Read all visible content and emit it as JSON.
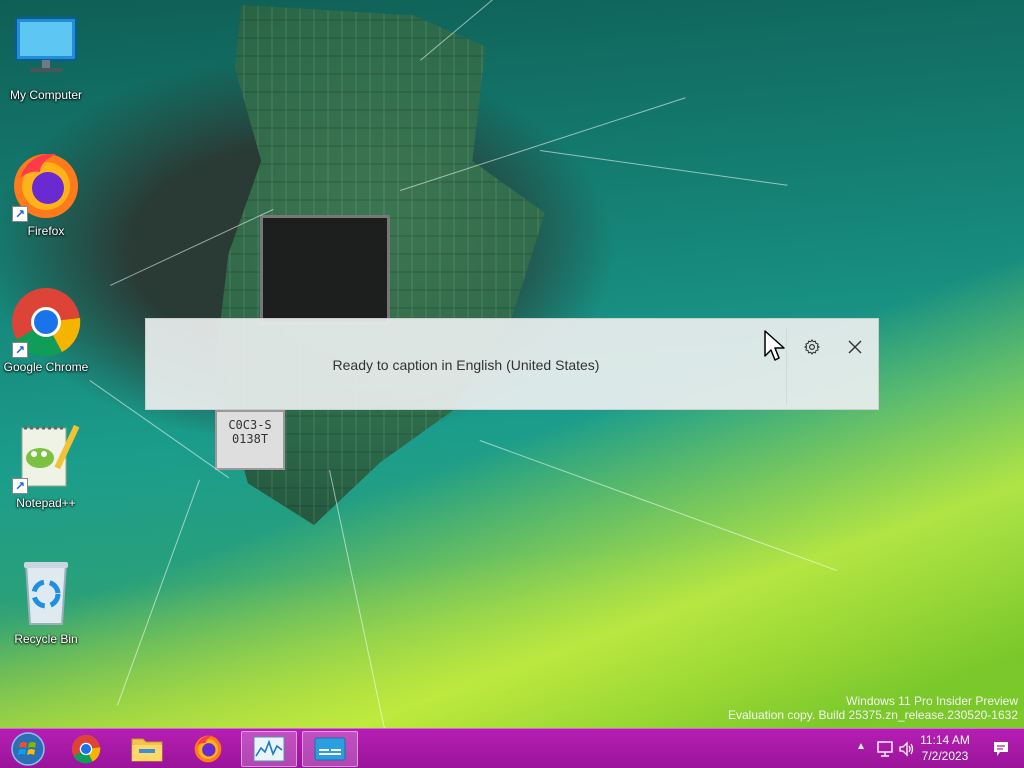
{
  "desktop": {
    "icons": [
      {
        "label": "My Computer",
        "icon": "monitor-icon"
      },
      {
        "label": "Firefox",
        "icon": "firefox-icon"
      },
      {
        "label": "Google Chrome",
        "icon": "chrome-icon"
      },
      {
        "label": "Notepad++",
        "icon": "notepadpp-icon"
      },
      {
        "label": "Recycle Bin",
        "icon": "recycle-bin-icon"
      }
    ],
    "chip_marking": "C0C3-S\n0138T"
  },
  "caption_window": {
    "status_text": "Ready to caption in English (United States)",
    "settings_icon": "gear-icon",
    "close_icon": "close-icon"
  },
  "watermark": {
    "line1": "Windows 11 Pro Insider Preview",
    "line2": "Evaluation copy. Build 25375.zn_release.230520-1632"
  },
  "taskbar": {
    "start_icon": "windows-start-icon",
    "apps": [
      {
        "name": "Google Chrome",
        "icon": "chrome-icon"
      },
      {
        "name": "File Explorer",
        "icon": "folder-icon"
      },
      {
        "name": "Firefox",
        "icon": "firefox-icon"
      },
      {
        "name": "Task Manager",
        "icon": "performance-chart-icon"
      },
      {
        "name": "Live Captions",
        "icon": "captions-icon"
      }
    ],
    "clock": {
      "time": "11:14 AM",
      "date": "7/2/2023"
    }
  },
  "colors": {
    "taskbar": "#a519a4",
    "accent_firefox": "#ff7a1a",
    "accent_chrome_blue": "#1a73e8"
  }
}
